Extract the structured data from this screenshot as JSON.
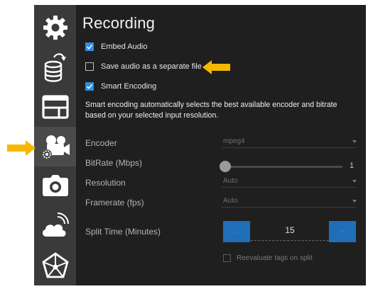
{
  "panel": {
    "title": "Recording",
    "embed_audio": {
      "label": "Embed Audio",
      "checked": true
    },
    "save_audio_separate": {
      "label": "Save audio as a separate file",
      "checked": false
    },
    "smart_encoding": {
      "label": "Smart Encoding",
      "checked": true
    },
    "description": "Smart encoding automatically selects the best available encoder and bitrate based on your selected input resolution.",
    "encoder": {
      "label": "Encoder",
      "value": "mpeg4"
    },
    "bitrate": {
      "label": "BitRate (Mbps)",
      "value": "1"
    },
    "resolution": {
      "label": "Resolution",
      "value": "Auto"
    },
    "framerate": {
      "label": "Framerate (fps)",
      "value": "Auto"
    },
    "split_time": {
      "label": "Split Time (Minutes)",
      "value": "15",
      "decrement": "–",
      "increment": "+"
    },
    "reevaluate_tags": {
      "label": "Reevaluate tags on split",
      "checked": false
    }
  },
  "sidebar": {
    "items": [
      {
        "icon": "gear-icon",
        "active": false
      },
      {
        "icon": "database-upload-icon",
        "active": false
      },
      {
        "icon": "layout-window-icon",
        "active": false
      },
      {
        "icon": "video-camera-settings-icon",
        "active": true
      },
      {
        "icon": "camera-icon",
        "active": false
      },
      {
        "icon": "cloud-signal-icon",
        "active": false
      },
      {
        "icon": "network-pentagon-icon",
        "active": false
      }
    ]
  },
  "colors": {
    "accent": "#2f8de4",
    "annotation_arrow": "#f5b800",
    "background": "#1f1f1f",
    "sidebar": "#3a3a3a"
  }
}
